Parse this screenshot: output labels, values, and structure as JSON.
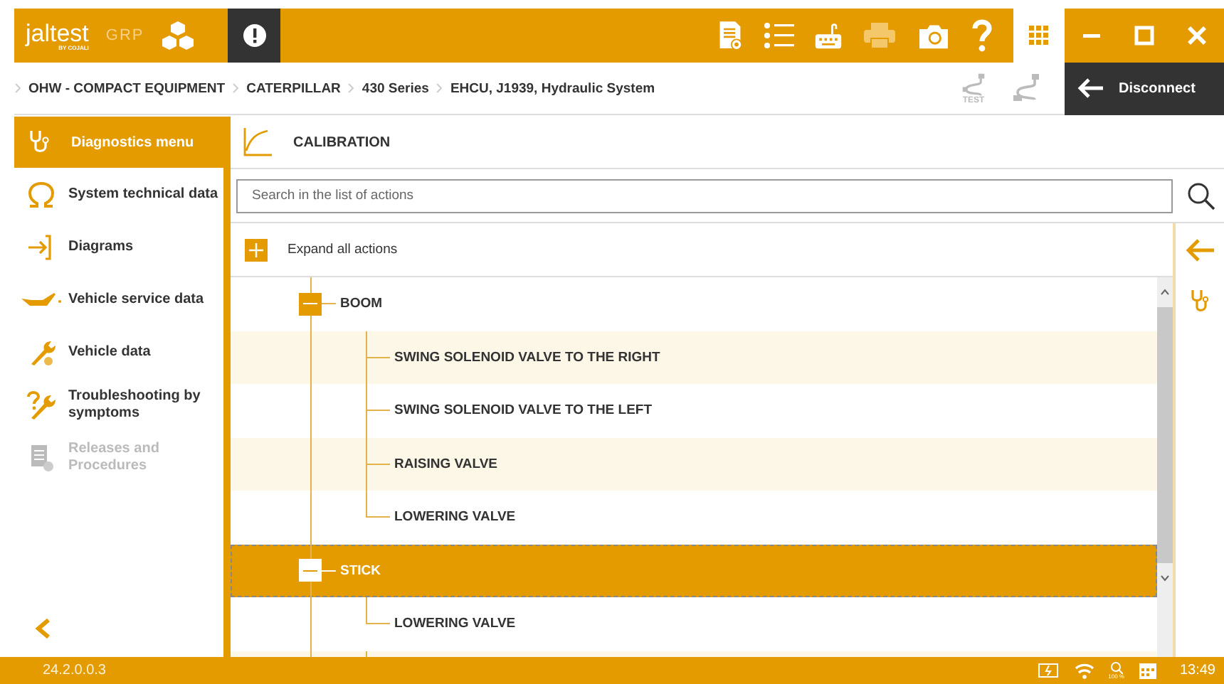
{
  "app": {
    "logo": "jaltest",
    "logo_sub": "BY COJALI",
    "edition": "GRP"
  },
  "breadcrumb": [
    "OHW - COMPACT EQUIPMENT",
    "CATERPILLAR",
    "430 Series",
    "EHCU, J1939, Hydraulic System"
  ],
  "connector_test_label": "TEST",
  "disconnect_button": "Disconnect",
  "sidebar": {
    "header": "Diagnostics menu",
    "items": [
      {
        "label": "System technical data",
        "disabled": false
      },
      {
        "label": "Diagrams",
        "disabled": false
      },
      {
        "label": "Vehicle service data",
        "disabled": false
      },
      {
        "label": "Vehicle data",
        "disabled": false
      },
      {
        "label": "Troubleshooting by symptoms",
        "disabled": false
      },
      {
        "label": "Releases and Procedures",
        "disabled": true
      }
    ]
  },
  "content": {
    "title": "CALIBRATION",
    "search": {
      "placeholder": "Search in the list of actions"
    },
    "expand_all": "Expand all actions",
    "tree": [
      {
        "label": "BOOM",
        "expanded": true,
        "selected": false,
        "children": [
          {
            "label": "SWING SOLENOID VALVE TO THE RIGHT"
          },
          {
            "label": "SWING SOLENOID VALVE TO THE LEFT"
          },
          {
            "label": "RAISING VALVE"
          },
          {
            "label": "LOWERING VALVE"
          }
        ]
      },
      {
        "label": "STICK",
        "expanded": true,
        "selected": true,
        "children": [
          {
            "label": "LOWERING VALVE"
          }
        ]
      }
    ]
  },
  "status_bar": {
    "version": "24.2.0.0.3",
    "zoom": "100 %",
    "time": "13:49"
  }
}
